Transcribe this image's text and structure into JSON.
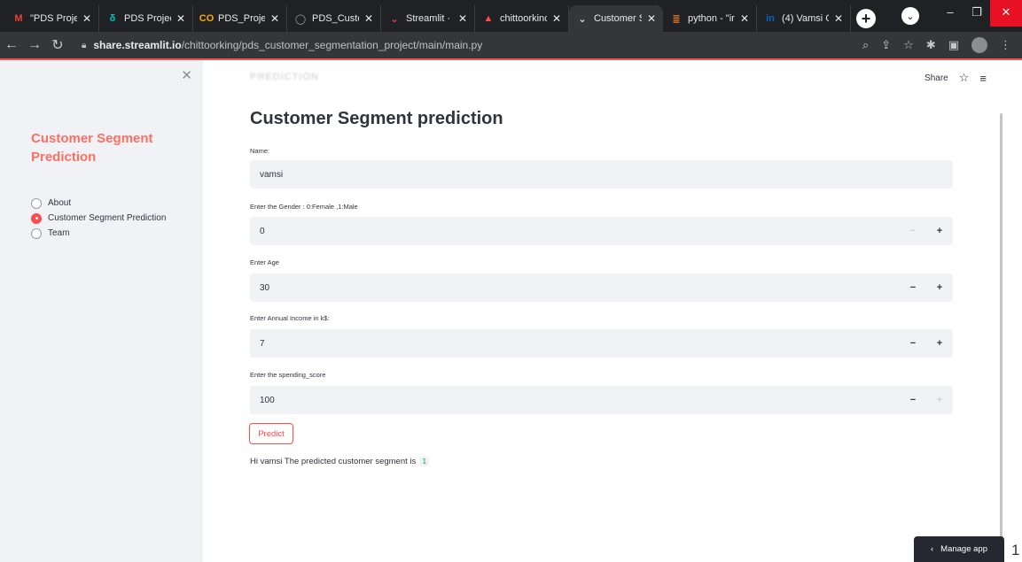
{
  "browser": {
    "tabs": [
      {
        "title": "\"PDS Projec",
        "icon": "gmail-icon",
        "color": "#ea4335",
        "glyph": "M"
      },
      {
        "title": "PDS Project",
        "icon": "flow-icon",
        "color": "#00c4b4",
        "glyph": "δ"
      },
      {
        "title": "PDS_Projec",
        "icon": "colab-icon",
        "color": "#f9ab00",
        "glyph": "CO"
      },
      {
        "title": "PDS_Custo",
        "icon": "github-icon",
        "color": "#9aa0a6",
        "glyph": "◯"
      },
      {
        "title": "Streamlit · T",
        "icon": "streamlit-icon",
        "color": "#ff4b4b",
        "glyph": "⌄"
      },
      {
        "title": "chittoorkinc",
        "icon": "streamlit-share-icon",
        "color": "#ff4b4b",
        "glyph": "▲"
      },
      {
        "title": "Customer S",
        "icon": "streamlit-icon",
        "color": "#e8eaed",
        "glyph": "⌄",
        "active": true
      },
      {
        "title": "python - \"ir",
        "icon": "stackoverflow-icon",
        "color": "#f48024",
        "glyph": "≣"
      },
      {
        "title": "(4) Vamsi C",
        "icon": "linkedin-icon",
        "color": "#0a66c2",
        "glyph": "in"
      }
    ],
    "url_host": "share.streamlit.io",
    "url_path": "/chittoorking/pds_customer_segmentation_project/main/main.py"
  },
  "sidebar": {
    "title": "Customer Segment Prediction",
    "options": [
      {
        "label": "About",
        "selected": false
      },
      {
        "label": "Customer Segment Prediction",
        "selected": true
      },
      {
        "label": "Team",
        "selected": false
      }
    ]
  },
  "main": {
    "ghost_header": "PREDICTION",
    "share_label": "Share",
    "title": "Customer Segment prediction",
    "name_label": "Name:",
    "name_value": "vamsi",
    "gender_label": "Enter the Gender : 0:Female ,1:Male",
    "gender_value": "0",
    "age_label": "Enter Age",
    "age_value": "30",
    "income_label": "Enter Annual Income in k$:",
    "income_value": "7",
    "spending_label": "Enter the spending_score",
    "spending_value": "100",
    "predict_label": "Predict",
    "result_text": "Hi vamsi The predicted customer segment is",
    "result_value": "1"
  },
  "manage_app_label": "Manage app",
  "edge_number": "1",
  "colors": {
    "accent": "#ff4b4b",
    "sidebar_title": "#ff6f61",
    "input_bg": "#f0f2f6"
  }
}
